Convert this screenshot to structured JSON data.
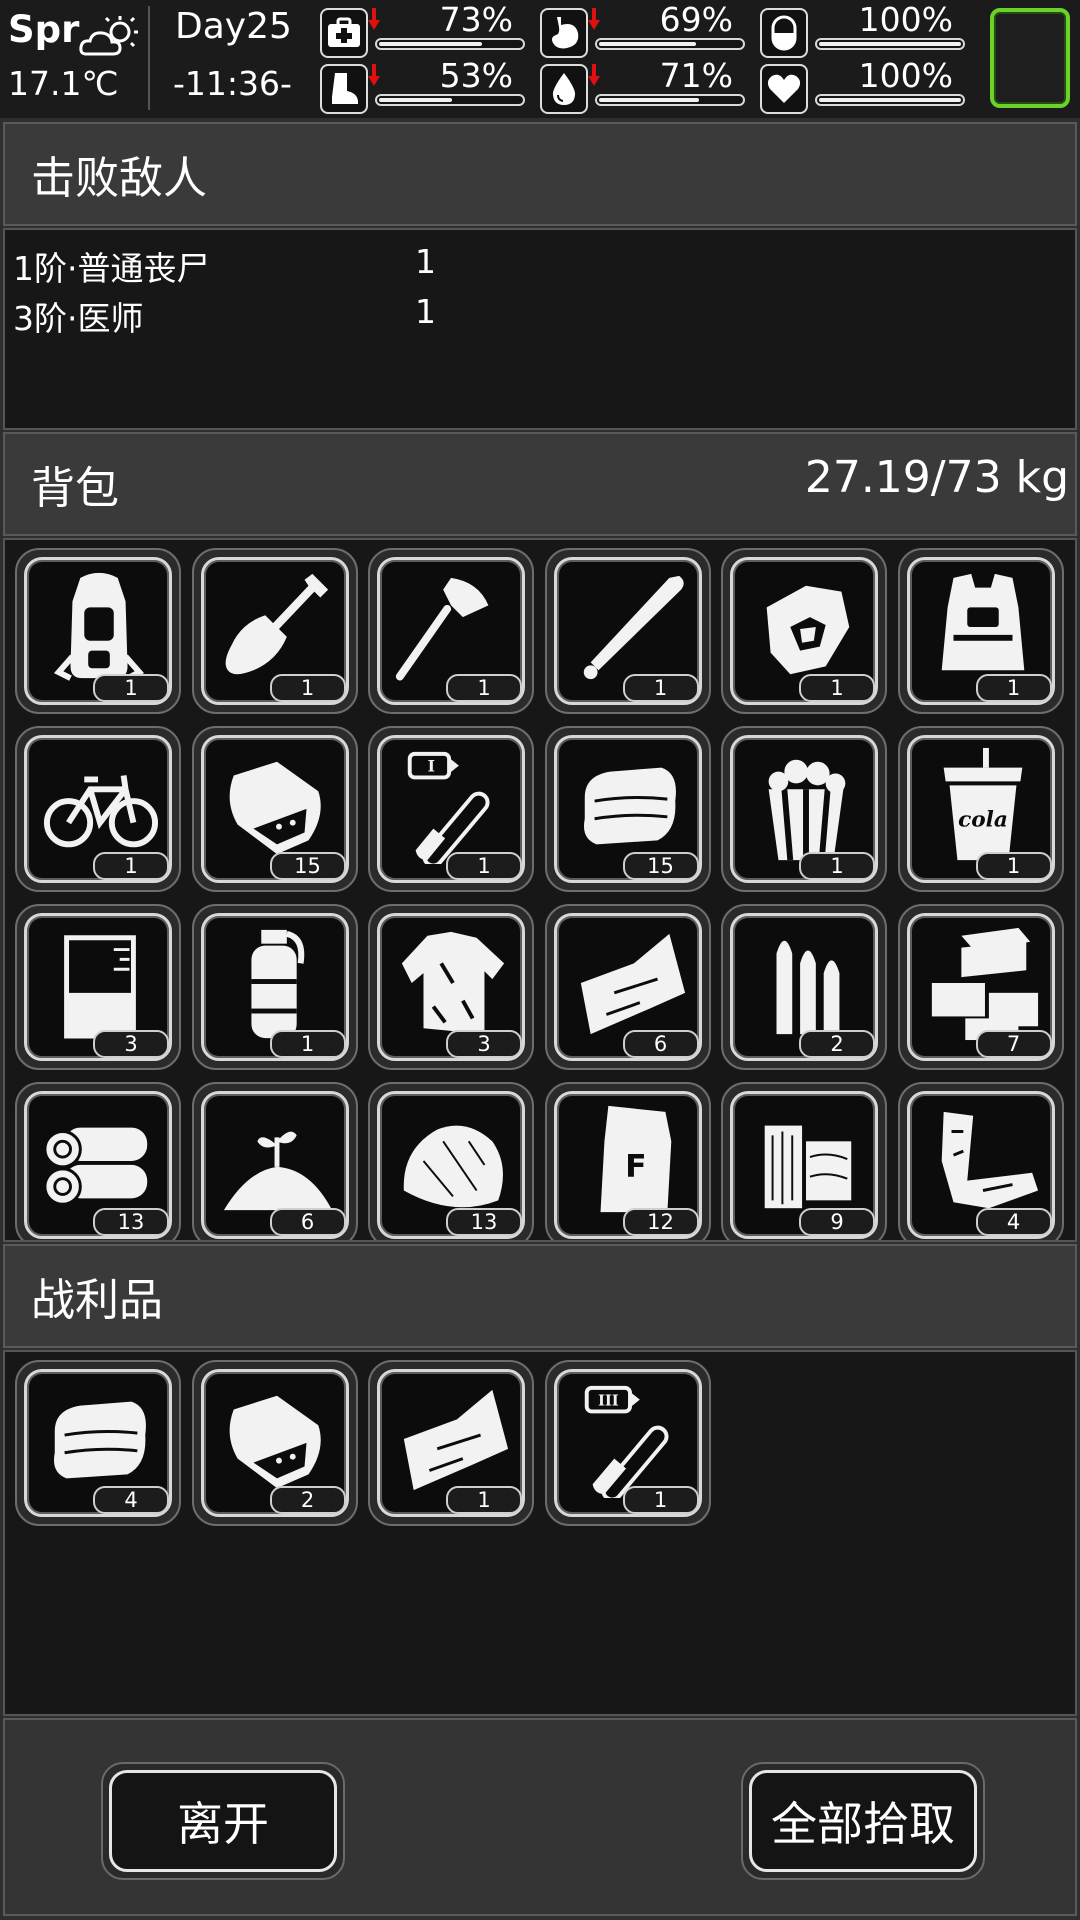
{
  "status": {
    "season": "Spr",
    "temperature": "17.1℃",
    "day": "Day25",
    "time": "-11:36-",
    "weather_icon": "partly-cloudy-icon",
    "stats": [
      {
        "name": "health",
        "icon": "medkit-icon",
        "value": 73,
        "label": "73%",
        "trend": "down"
      },
      {
        "name": "hunger",
        "icon": "stomach-icon",
        "value": 69,
        "label": "69%",
        "trend": "down"
      },
      {
        "name": "sleep",
        "icon": "capsule-icon",
        "value": 100,
        "label": "100%",
        "trend": "none"
      },
      {
        "name": "stamina",
        "icon": "foot-icon",
        "value": 53,
        "label": "53%",
        "trend": "down"
      },
      {
        "name": "thirst",
        "icon": "water-drop-icon",
        "value": 71,
        "label": "71%",
        "trend": "down"
      },
      {
        "name": "mood",
        "icon": "heart-icon",
        "value": 100,
        "label": "100%",
        "trend": "none"
      }
    ],
    "accent_color": "#6cd128",
    "trend_down_color": "#e01010"
  },
  "enemies": {
    "title": "击败敌人",
    "rows": [
      {
        "name": "1阶·普通丧尸",
        "count": "1"
      },
      {
        "name": "3阶·医师",
        "count": "1"
      }
    ]
  },
  "backpack": {
    "title": "背包",
    "weight": "27.19/73 kg",
    "items": [
      {
        "icon": "backpack-icon",
        "count": "1"
      },
      {
        "icon": "shovel-icon",
        "count": "1"
      },
      {
        "icon": "axe-icon",
        "count": "1"
      },
      {
        "icon": "baseball-bat-icon",
        "count": "1"
      },
      {
        "icon": "gloves-icon",
        "count": "1"
      },
      {
        "icon": "armor-vest-icon",
        "count": "1"
      },
      {
        "icon": "bicycle-icon",
        "count": "1"
      },
      {
        "icon": "food-bag-icon",
        "count": "15"
      },
      {
        "icon": "test-tube-i-icon",
        "count": "1",
        "tag": "I"
      },
      {
        "icon": "cloth-icon",
        "count": "15"
      },
      {
        "icon": "popcorn-icon",
        "count": "1"
      },
      {
        "icon": "cola-cup-icon",
        "count": "1",
        "tag": "cola"
      },
      {
        "icon": "beaker-icon",
        "count": "3"
      },
      {
        "icon": "grenade-icon",
        "count": "1"
      },
      {
        "icon": "torn-shirt-icon",
        "count": "3"
      },
      {
        "icon": "fabric-sheet-icon",
        "count": "6"
      },
      {
        "icon": "bullets-icon",
        "count": "2"
      },
      {
        "icon": "bricks-icon",
        "count": "7"
      },
      {
        "icon": "logs-icon",
        "count": "13"
      },
      {
        "icon": "seedling-soil-icon",
        "count": "6"
      },
      {
        "icon": "straw-pile-icon",
        "count": "13"
      },
      {
        "icon": "flour-sack-icon",
        "count": "12",
        "tag": "F"
      },
      {
        "icon": "wood-planks-icon",
        "count": "9"
      },
      {
        "icon": "scrap-metal-icon",
        "count": "4"
      }
    ]
  },
  "loot": {
    "title": "战利品",
    "items": [
      {
        "icon": "cloth-icon",
        "count": "4"
      },
      {
        "icon": "food-bag-icon",
        "count": "2"
      },
      {
        "icon": "fabric-sheet-icon",
        "count": "1"
      },
      {
        "icon": "test-tube-iii-icon",
        "count": "1",
        "tag": "III"
      }
    ]
  },
  "buttons": {
    "leave": "离开",
    "take_all": "全部拾取"
  }
}
